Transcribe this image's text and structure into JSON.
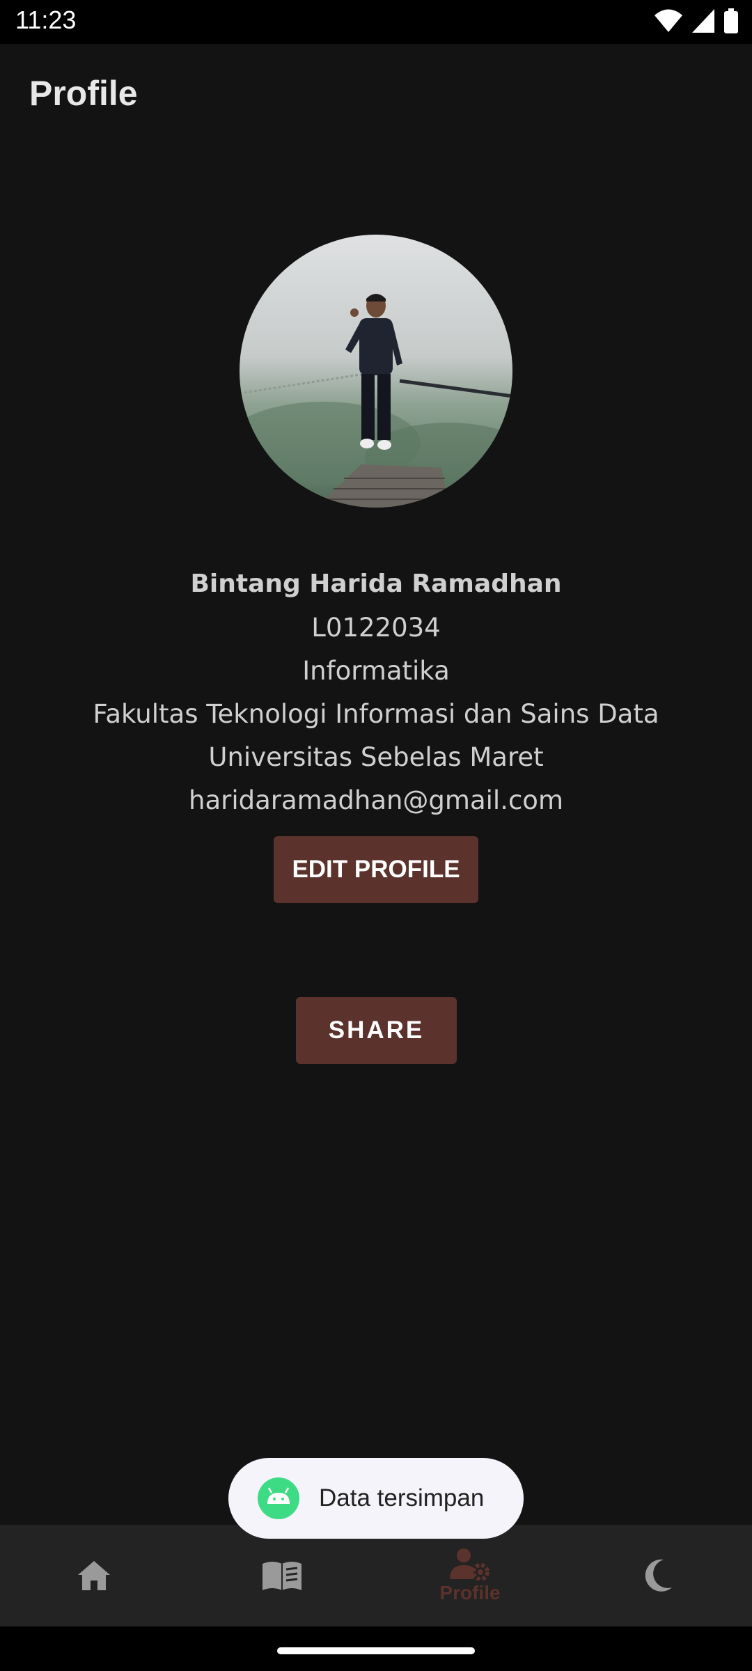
{
  "status_bar": {
    "time": "11:23"
  },
  "app_bar": {
    "title": "Profile"
  },
  "profile": {
    "name": "Bintang Harida Ramadhan",
    "nim": "L0122034",
    "program": "Informatika",
    "faculty": "Fakultas Teknologi Informasi dan Sains Data",
    "university": "Universitas Sebelas Maret",
    "email": "haridaramadhan@gmail.com"
  },
  "buttons": {
    "edit_profile": "EDIT PROFILE",
    "share": "SHARE"
  },
  "toast": {
    "message": "Data tersimpan",
    "icon": "android-icon"
  },
  "bottom_nav": {
    "items": [
      {
        "icon": "home-icon",
        "label": ""
      },
      {
        "icon": "book-icon",
        "label": ""
      },
      {
        "icon": "profile-settings-icon",
        "label": "Profile",
        "active": true
      },
      {
        "icon": "moon-icon",
        "label": ""
      }
    ]
  },
  "colors": {
    "accent": "#5b322c",
    "background": "#131313",
    "nav_background": "#232323"
  }
}
